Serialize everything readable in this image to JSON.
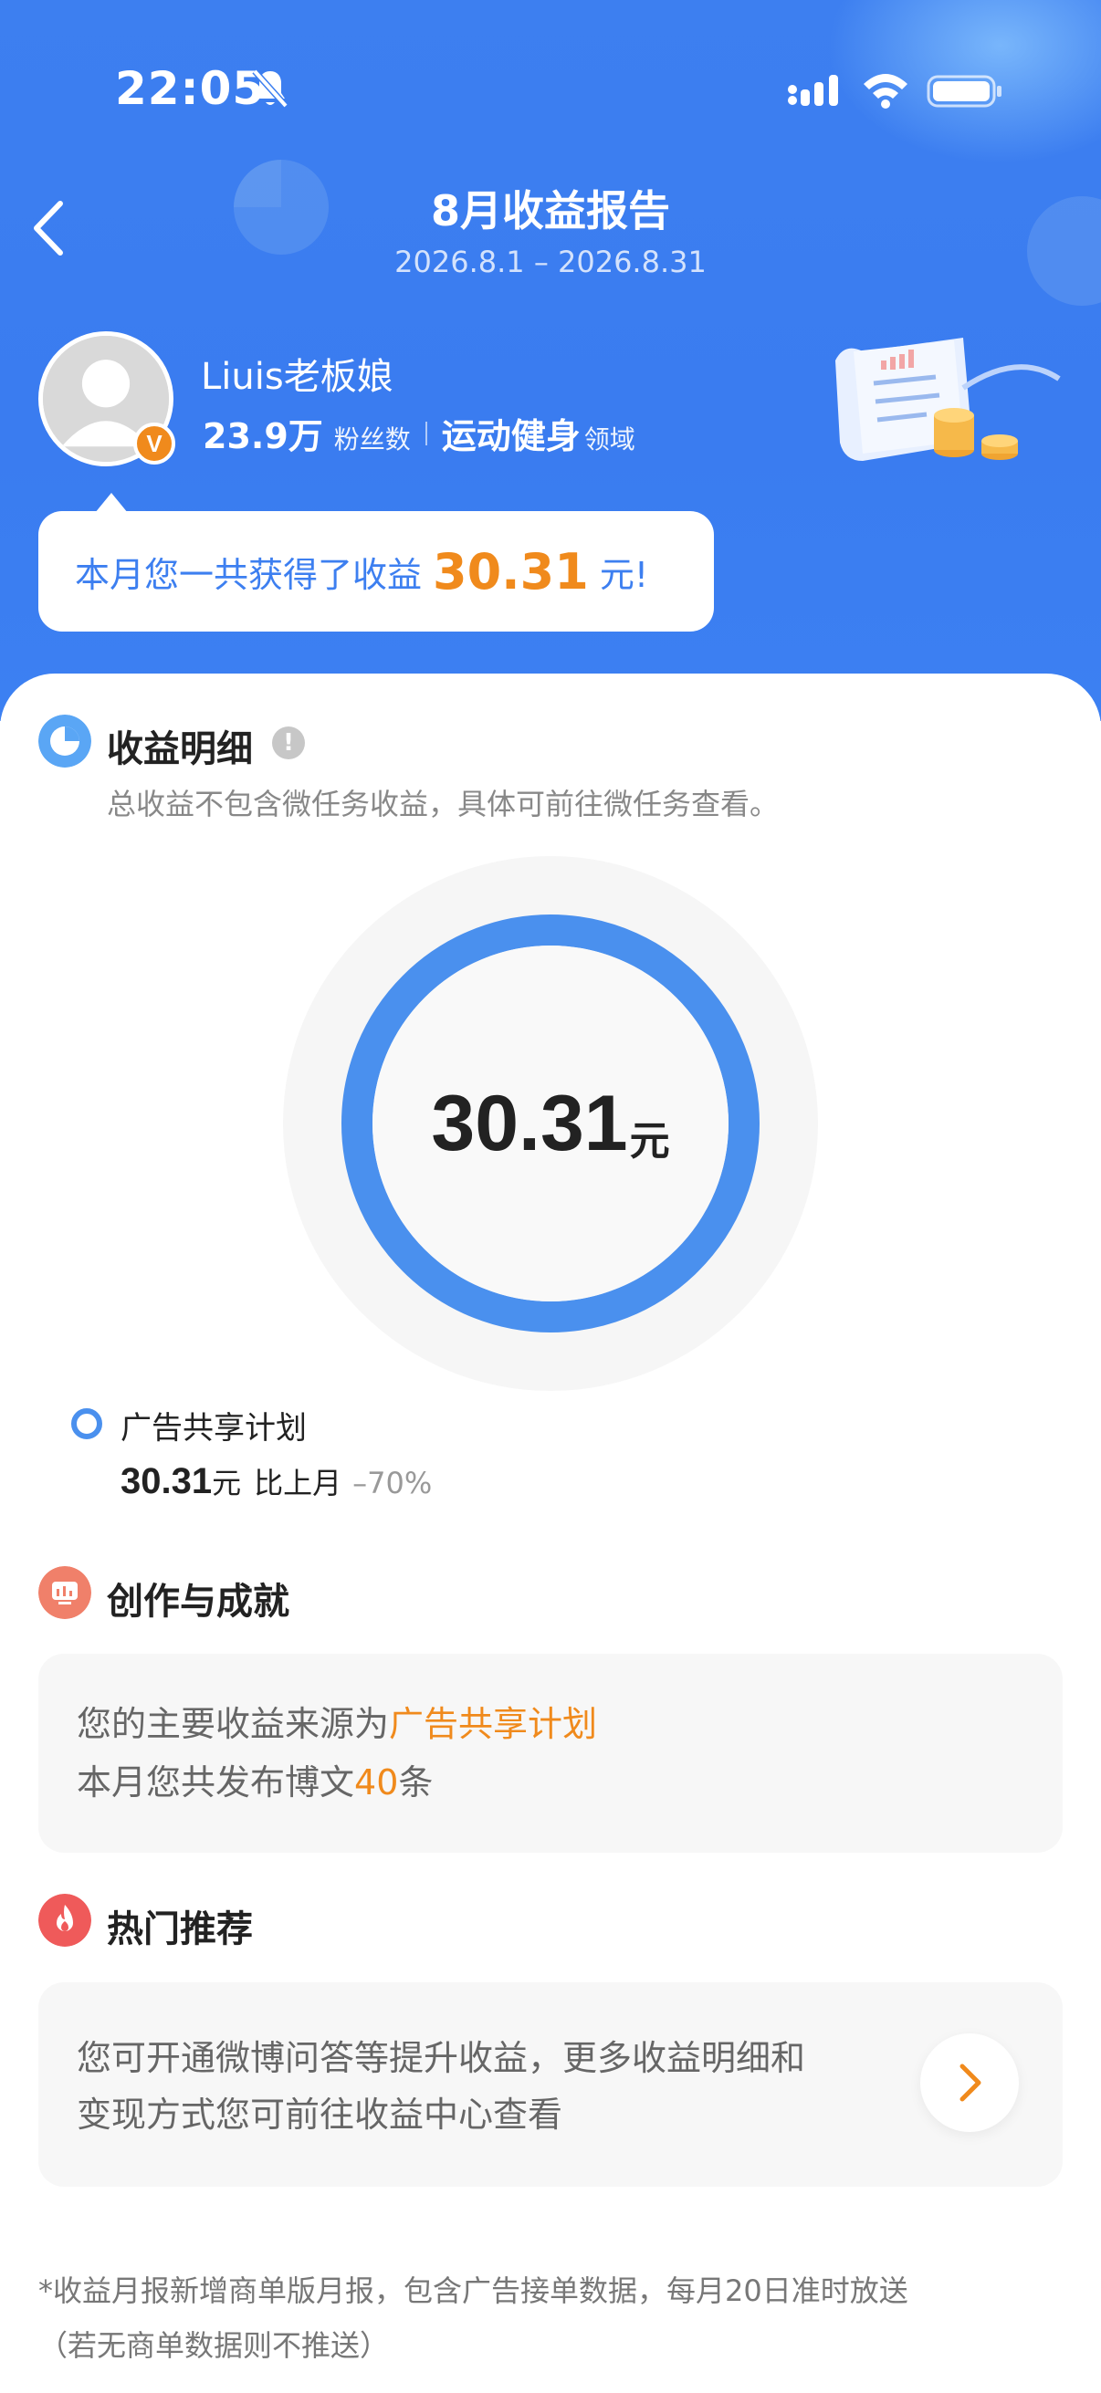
{
  "status_bar": {
    "time": "22:05",
    "icons": [
      "bell-muted-icon",
      "signal-icon",
      "wifi-icon",
      "battery-icon"
    ]
  },
  "header": {
    "title": "8月收益报告",
    "date_range": "2026.8.1 – 2026.8.31",
    "back_icon": "chevron-left-icon"
  },
  "profile": {
    "username": "Liuis老板娘",
    "badge": "V",
    "followers_value": "23.9万",
    "followers_label": "粉丝数",
    "domain_value": "运动健身",
    "domain_label": "领域"
  },
  "summary_bubble": {
    "prefix": "本月您一共获得了收益",
    "amount": "30.31",
    "suffix": "元!"
  },
  "earnings_detail": {
    "title": "收益明细",
    "info_icon": "!",
    "subtitle": "总收益不包含微任务收益，具体可前往微任务查看。",
    "total_value": "30.31",
    "total_unit": "元",
    "donut_share": 1.0,
    "legend": [
      {
        "name": "广告共享计划",
        "value": "30.31",
        "unit": "元",
        "compare_label": "比上月",
        "change": "–70%",
        "color": "#4a90ee"
      }
    ]
  },
  "creation": {
    "title": "创作与成就",
    "line1_prefix": "您的主要收益来源为",
    "line1_highlight": "广告共享计划",
    "line2_prefix": "本月您共发布博文",
    "line2_count": "40",
    "line2_suffix": "条"
  },
  "hot": {
    "title": "热门推荐",
    "line1": "您可开通微博问答等提升收益，更多收益明细和",
    "line2": "变现方式您可前往收益中心查看",
    "arrow_icon": "chevron-right-icon"
  },
  "footnote": {
    "line1": "*收益月报新增商单版月报，包含广告接单数据，每月20日准时放送",
    "line2": "（若无商单数据则不推送）"
  },
  "colors": {
    "header_blue": "#3d7ff0",
    "accent_orange": "#f08a1c",
    "donut_blue": "#4a90ee",
    "creation_icon": "#f0806a",
    "hot_icon": "#ef5a5a"
  }
}
